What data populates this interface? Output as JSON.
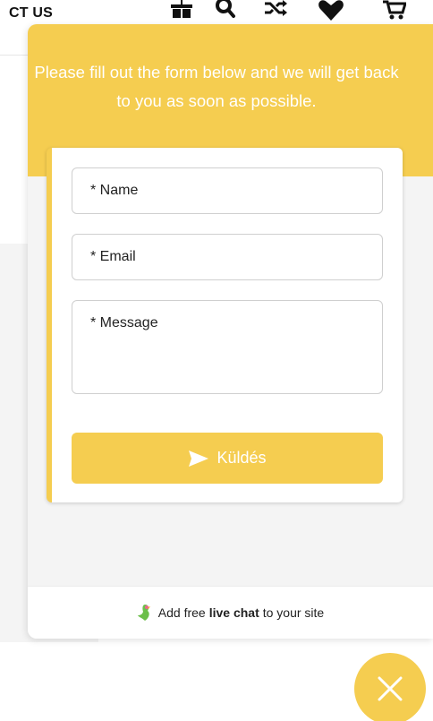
{
  "site": {
    "header_fragment": "CT US",
    "icons": [
      "gift-icon",
      "search-icon",
      "shuffle-icon",
      "heart-icon",
      "cart-icon"
    ]
  },
  "widget": {
    "intro_text": "Please fill out the form below and we will get back to you as soon as possible.",
    "form": {
      "name_placeholder": "* Name",
      "email_placeholder": "* Email",
      "message_placeholder": "* Message",
      "submit_label": "Küldés"
    },
    "footer": {
      "prefix": "Add free",
      "bold": "live chat",
      "suffix": "to your site"
    }
  },
  "colors": {
    "accent": "#f5cd50",
    "panel_bg": "#f4f4f4",
    "text": "#222222"
  }
}
